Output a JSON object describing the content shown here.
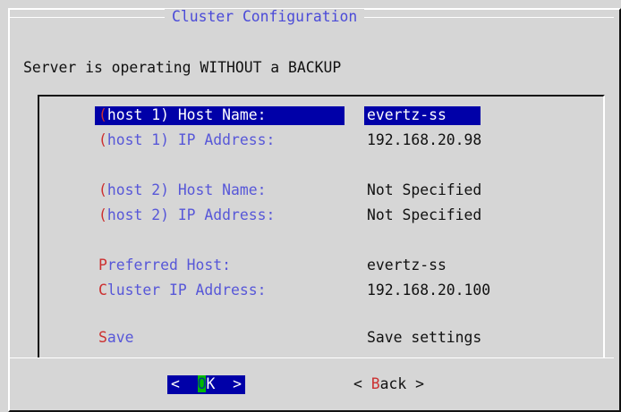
{
  "dialog": {
    "title": "Cluster Configuration",
    "status": "Server is operating WITHOUT a BACKUP"
  },
  "menu": {
    "items": [
      {
        "hotkey": "(",
        "label_rest": "host 1) Host Name:",
        "value": "evertz-ss",
        "selected": true
      },
      {
        "hotkey": "(",
        "label_rest": "host 1) IP Address:",
        "value": "192.168.20.98",
        "selected": false
      },
      {
        "hotkey": "(",
        "label_rest": "host 2) Host Name:",
        "value": "Not Specified",
        "selected": false
      },
      {
        "hotkey": "(",
        "label_rest": "host 2) IP Address:",
        "value": "Not Specified",
        "selected": false
      },
      {
        "hotkey": "P",
        "label_rest": "referred Host:",
        "value": "evertz-ss",
        "selected": false
      },
      {
        "hotkey": "C",
        "label_rest": "luster IP Address:",
        "value": "192.168.20.100",
        "selected": false
      },
      {
        "hotkey": "S",
        "label_rest": "ave",
        "value": "Save settings",
        "selected": false
      }
    ]
  },
  "buttons": {
    "ok": {
      "left": "<  ",
      "hotkey": "O",
      "rest": "K  >"
    },
    "back": {
      "left": "< ",
      "hotkey": "B",
      "rest": "ack >"
    }
  },
  "colors": {
    "background": "#d6d6d6",
    "selection": "#0000a8",
    "hotkey": "#cc3030",
    "label": "#5757d8",
    "cursor": "#00b800"
  }
}
